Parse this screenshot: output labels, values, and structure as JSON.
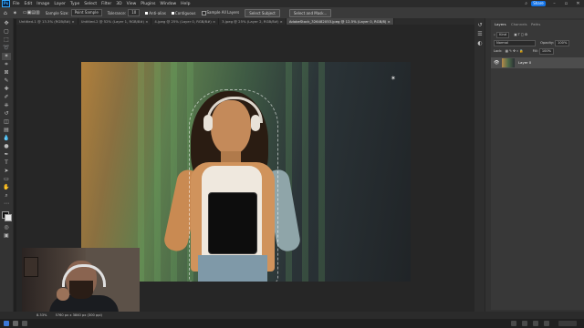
{
  "menubar": {
    "logo": "Ps",
    "items": [
      "File",
      "Edit",
      "Image",
      "Layer",
      "Type",
      "Select",
      "Filter",
      "3D",
      "View",
      "Plugins",
      "Window",
      "Help"
    ],
    "share": "Share"
  },
  "options": {
    "sample_size_label": "Sample Size:",
    "sample_size_value": "Point Sample",
    "tolerance_label": "Tolerance:",
    "tolerance_value": "10",
    "anti_alias": "Anti-alias",
    "contiguous": "Contiguous",
    "sample_all_layers": "Sample All Layers",
    "select_subject": "Select Subject",
    "select_and_mask": "Select and Mask..."
  },
  "tabs": [
    {
      "label": "Untitled-1 @ 13.3% (RGB/8#) ×",
      "active": false
    },
    {
      "label": "Untitled-2 @ 52% (Layer 1, RGB/8#) ×",
      "active": false
    },
    {
      "label": "4.jpeg @ 25% (Layer 0, RGB/8#) ×",
      "active": false
    },
    {
      "label": "3.jpeg @ 25% (Layer 2, RGB/8#) ×",
      "active": false
    },
    {
      "label": "AdobeStock_326482053.jpeg @ 12.5% (Layer 0, RGB/8) ×",
      "active": true
    }
  ],
  "status": {
    "zoom": "8.33%",
    "dimensions": "5760 px x 3840 px (300 ppi)"
  },
  "panels": {
    "tabs": [
      "Layers",
      "Channels",
      "Paths"
    ],
    "kind": "Kind",
    "blend_mode": "Normal",
    "opacity_label": "Opacity:",
    "opacity_value": "100%",
    "lock_label": "Lock:",
    "fill_label": "Fill:",
    "fill_value": "100%",
    "layer_name": "Layer 0"
  }
}
